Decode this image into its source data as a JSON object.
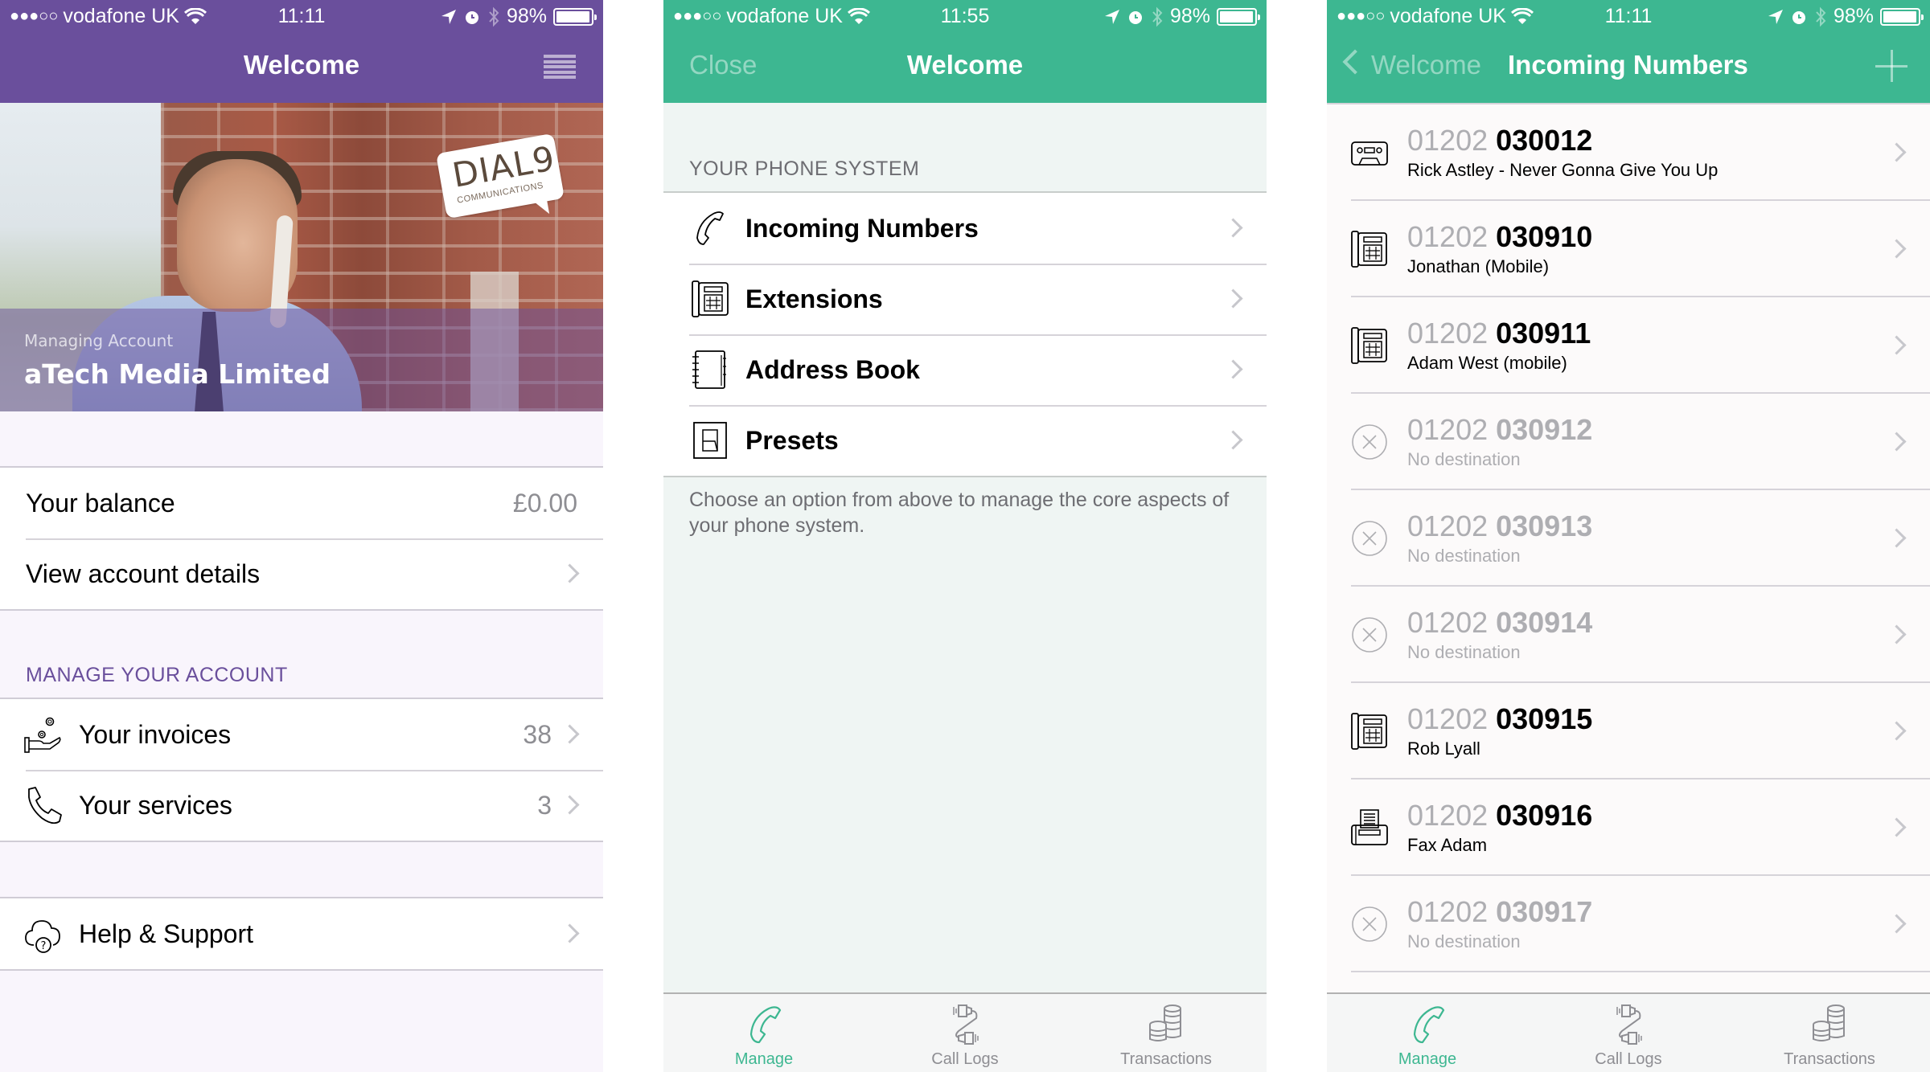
{
  "status_bars": [
    {
      "signal_dots": "●●●○○",
      "carrier": "vodafone UK",
      "time": "11:11",
      "battery": "98%",
      "battery_level": 0.98
    },
    {
      "signal_dots": "●●●○○",
      "carrier": "vodafone UK",
      "time": "11:55",
      "battery": "98%",
      "battery_level": 0.98
    },
    {
      "signal_dots": "●●●○○",
      "carrier": "vodafone UK",
      "time": "11:11",
      "battery": "98%",
      "battery_level": 0.98
    }
  ],
  "colors": {
    "purple_brand": "#6a4f9c",
    "green_brand": "#3db791",
    "chevron": "#c7c7cc",
    "secondary_text": "#8e8e93"
  },
  "account_screen": {
    "title": "Welcome",
    "menu_icon": "hamburger-menu-icon",
    "hero": {
      "label": "Managing Account",
      "account_name": "aTech Media Limited",
      "logo_main": "DIAL9",
      "logo_sub": "COMMUNICATIONS"
    },
    "summary_rows": [
      {
        "label": "Your balance",
        "value": "£0.00"
      },
      {
        "label": "View account details",
        "value": ""
      }
    ],
    "manage_section_header": "MANAGE YOUR ACCOUNT",
    "manage_rows": [
      {
        "icon": "invoice-hand-coins-icon",
        "label": "Your invoices",
        "value": "38"
      },
      {
        "icon": "phone-handset-icon",
        "label": "Your services",
        "value": "3"
      }
    ],
    "help_row": {
      "icon": "cloud-help-icon",
      "label": "Help & Support"
    }
  },
  "phone_system_screen": {
    "close_label": "Close",
    "title": "Welcome",
    "section_header": "YOUR PHONE SYSTEM",
    "rows": [
      {
        "icon": "incoming-call-icon",
        "label": "Incoming Numbers"
      },
      {
        "icon": "desk-phone-icon",
        "label": "Extensions"
      },
      {
        "icon": "address-book-icon",
        "label": "Address Book"
      },
      {
        "icon": "switch-preset-icon",
        "label": "Presets"
      }
    ],
    "footer_note": "Choose an option from above to manage the core aspects of your phone system."
  },
  "incoming_numbers_screen": {
    "back_label": "Welcome",
    "title": "Incoming Numbers",
    "add_icon": "plus-icon",
    "numbers": [
      {
        "prefix": "01202",
        "number": "030012",
        "description": "Rick Astley - Never Gonna Give You Up",
        "icon": "cassette-icon",
        "active": true
      },
      {
        "prefix": "01202",
        "number": "030910",
        "description": "Jonathan (Mobile)",
        "icon": "desk-phone-icon",
        "active": true
      },
      {
        "prefix": "01202",
        "number": "030911",
        "description": "Adam West (mobile)",
        "icon": "desk-phone-icon",
        "active": true
      },
      {
        "prefix": "01202",
        "number": "030912",
        "description": "No destination",
        "icon": "no-destination-icon",
        "active": false
      },
      {
        "prefix": "01202",
        "number": "030913",
        "description": "No destination",
        "icon": "no-destination-icon",
        "active": false
      },
      {
        "prefix": "01202",
        "number": "030914",
        "description": "No destination",
        "icon": "no-destination-icon",
        "active": false
      },
      {
        "prefix": "01202",
        "number": "030915",
        "description": "Rob Lyall",
        "icon": "desk-phone-icon",
        "active": true
      },
      {
        "prefix": "01202",
        "number": "030916",
        "description": "Fax Adam",
        "icon": "fax-icon",
        "active": true
      },
      {
        "prefix": "01202",
        "number": "030917",
        "description": "No destination",
        "icon": "no-destination-icon",
        "active": false
      }
    ]
  },
  "tab_bar": {
    "tabs": [
      {
        "label": "Manage",
        "icon": "manage-phone-icon",
        "active": true
      },
      {
        "label": "Call Logs",
        "icon": "call-logs-cable-icon",
        "active": false
      },
      {
        "label": "Transactions",
        "icon": "coins-stack-icon",
        "active": false
      }
    ]
  }
}
